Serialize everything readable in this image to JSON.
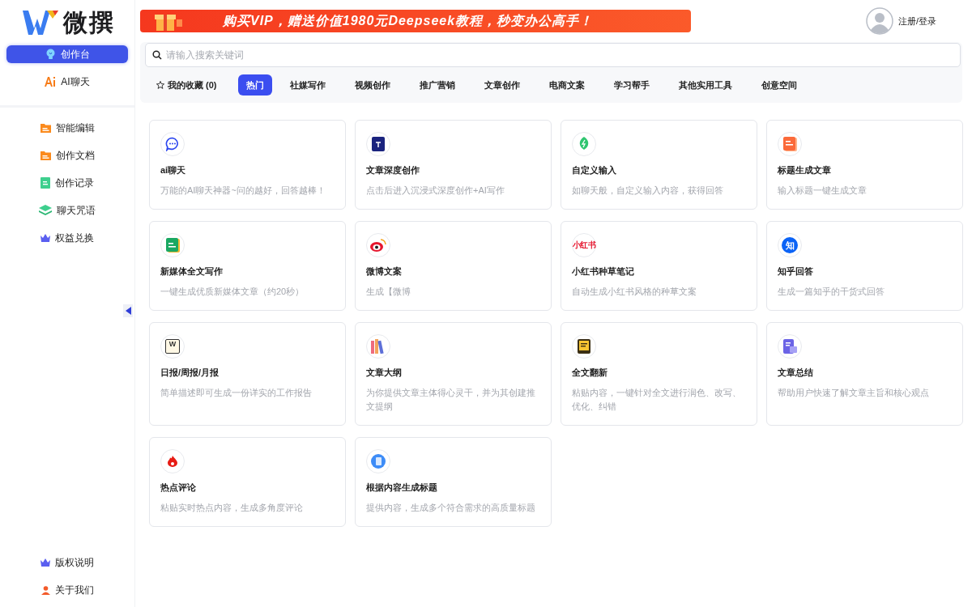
{
  "logo": {
    "text": "微撰"
  },
  "banner": {
    "text": "购买VIP，赠送价值1980元Deepseek教程，秒变办公高手！"
  },
  "user": {
    "label": "注册/登录"
  },
  "sidebar": {
    "top_items": [
      {
        "label": "创作台",
        "kind": "bulb",
        "selected": true
      },
      {
        "label": "AI聊天",
        "kind": "ai",
        "selected": false
      }
    ],
    "items": [
      {
        "label": "智能编辑",
        "kind": "folder",
        "selected": false
      },
      {
        "label": "创作文档",
        "kind": "folder",
        "selected": false
      },
      {
        "label": "创作记录",
        "kind": "document",
        "selected": false
      },
      {
        "label": "聊天咒语",
        "kind": "layers",
        "selected": false
      },
      {
        "label": "权益兑换",
        "kind": "crown",
        "selected": false
      }
    ],
    "bottom_items": [
      {
        "label": "版权说明",
        "kind": "crown",
        "selected": false
      },
      {
        "label": "关于我们",
        "kind": "person",
        "selected": false
      }
    ]
  },
  "search": {
    "placeholder": "请输入搜索关键词"
  },
  "tabs": [
    {
      "label": "我的收藏 (0)",
      "kind": "favorites",
      "selected": false
    },
    {
      "label": "热门",
      "kind": "category",
      "selected": true
    },
    {
      "label": "社媒写作",
      "kind": "category",
      "selected": false
    },
    {
      "label": "视频创作",
      "kind": "category",
      "selected": false
    },
    {
      "label": "推广营销",
      "kind": "category",
      "selected": false
    },
    {
      "label": "文章创作",
      "kind": "category",
      "selected": false
    },
    {
      "label": "电商文案",
      "kind": "category",
      "selected": false
    },
    {
      "label": "学习帮手",
      "kind": "category",
      "selected": false
    },
    {
      "label": "其他实用工具",
      "kind": "category",
      "selected": false
    },
    {
      "label": "创意空间",
      "kind": "category",
      "selected": false
    }
  ],
  "cards": [
    {
      "title": "ai聊天",
      "description": "万能的AI聊天神器~问的越好，回答越棒！",
      "kind": "chat"
    },
    {
      "title": "文章深度创作",
      "description": "点击后进入沉浸式深度创作+AI写作",
      "kind": "square"
    },
    {
      "title": "自定义输入",
      "description": "如聊天般，自定义输入内容，获得回答",
      "kind": "leaf"
    },
    {
      "title": "标题生成文章",
      "description": "输入标题一键生成文章",
      "kind": "doc-orange"
    },
    {
      "title": "新媒体全文写作",
      "description": "一键生成优质新媒体文章（约20秒）",
      "kind": "doc-green"
    },
    {
      "title": "微博文案",
      "description": "生成【微博",
      "kind": "eye"
    },
    {
      "title": "小红书种草笔记",
      "description": "自动生成小红书风格的种草文案",
      "kind": "xhs",
      "icon_text": "小红书"
    },
    {
      "title": "知乎回答",
      "description": "生成一篇知乎的干货式回答",
      "kind": "zhihu",
      "icon_text": "知"
    },
    {
      "title": "日报/周报/月报",
      "description": "简单描述即可生成一份详实的工作报告",
      "kind": "report",
      "icon_text": "W"
    },
    {
      "title": "文章大纲",
      "description": "为你提供文章主体得心灵干，并为其创建推文提纲",
      "kind": "books"
    },
    {
      "title": "全文翻新",
      "description": "粘贴内容，一键针对全文进行润色、改写、优化、纠错",
      "kind": "book"
    },
    {
      "title": "文章总结",
      "description": "帮助用户快速了解文章主旨和核心观点",
      "kind": "doc-purple"
    },
    {
      "title": "热点评论",
      "description": "粘贴实时热点内容，生成多角度评论",
      "kind": "flame"
    },
    {
      "title": "根据内容生成标题",
      "description": "提供内容，生成多个符合需求的高质量标题",
      "kind": "doc-blue"
    }
  ]
}
